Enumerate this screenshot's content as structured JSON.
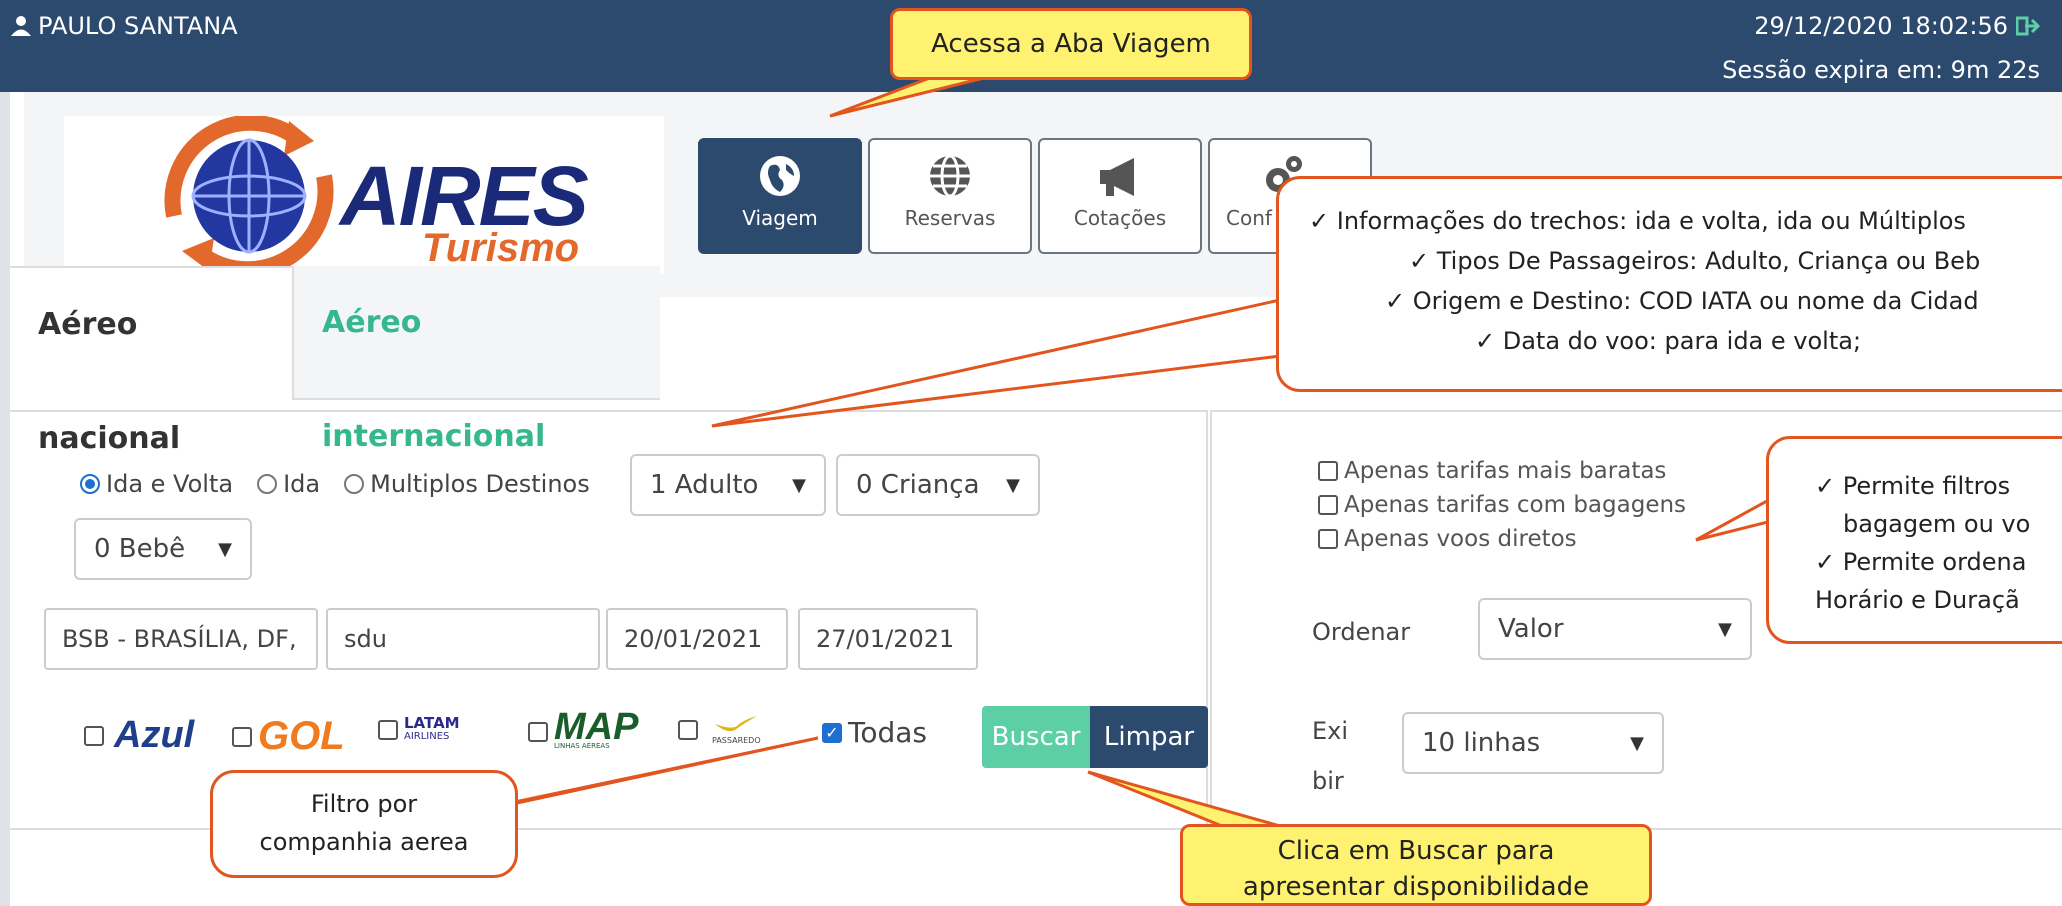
{
  "topbar": {
    "user": "PAULO SANTANA",
    "datetime": "29/12/2020 18:02:56",
    "session": "Sessão expira em: 9m 22s"
  },
  "logo": {
    "name": "AIRES",
    "sub": "Turismo"
  },
  "nav": [
    {
      "label": "Viagem",
      "icon": "globe-icon",
      "active": true
    },
    {
      "label": "Reservas",
      "icon": "globe-grid-icon"
    },
    {
      "label": "Cotações",
      "icon": "megaphone-icon"
    },
    {
      "label": "Conf",
      "icon": "gears-icon"
    }
  ],
  "tabs": {
    "national": "Aéreo nacional",
    "international": "Aéreo internacional"
  },
  "trip": {
    "options": [
      "Ida e Volta",
      "Ida",
      "Multiplos Destinos"
    ],
    "selected": "Ida e Volta",
    "adults": "1 Adulto",
    "children": "0 Criança",
    "infants": "0 Bebê",
    "origin": "BSB - BRASÍLIA, DF,",
    "destination": "sdu",
    "date_out": "20/01/2021",
    "date_return": "27/01/2021"
  },
  "airlines": {
    "azul": "Azul",
    "gol": "GOL",
    "latam": "LATAM",
    "latam_sub": "AIRLINES",
    "map": "MAP",
    "map_sub": "LINHAS AÉREAS",
    "passaredo": "PASSAREDO",
    "todas": "Todas"
  },
  "buttons": {
    "buscar": "Buscar",
    "limpar": "Limpar"
  },
  "filters": {
    "cheapest": "Apenas tarifas mais baratas",
    "baggage": "Apenas tarifas com bagagens",
    "direct": "Apenas voos diretos",
    "order_label": "Ordenar",
    "order_value": "Valor",
    "show_label": "Exibir",
    "show_value": "10 linhas"
  },
  "callouts": {
    "aba": "Acessa a Aba Viagem",
    "info": [
      "✓ Informações do trechos: ida e volta, ida ou Múltiplos",
      "✓ Tipos De Passageiros: Adulto, Criança ou Beb",
      "✓ Origem e Destino: COD IATA ou nome da Cidad",
      "✓ Data do voo: para ida e volta;"
    ],
    "filtros": [
      "✓ Permite filtros",
      "bagagem ou vo",
      "✓ Permite ordena",
      "Horário e Duraçã"
    ],
    "companhia": "Filtro por companhia aerea",
    "buscar": "Clica em Buscar para apresentar disponibilidade"
  },
  "colors": {
    "primary": "#2c4a6e",
    "accent": "#5ccfa6",
    "callout_border": "#e2551f",
    "callout_yellow": "#fff270"
  }
}
